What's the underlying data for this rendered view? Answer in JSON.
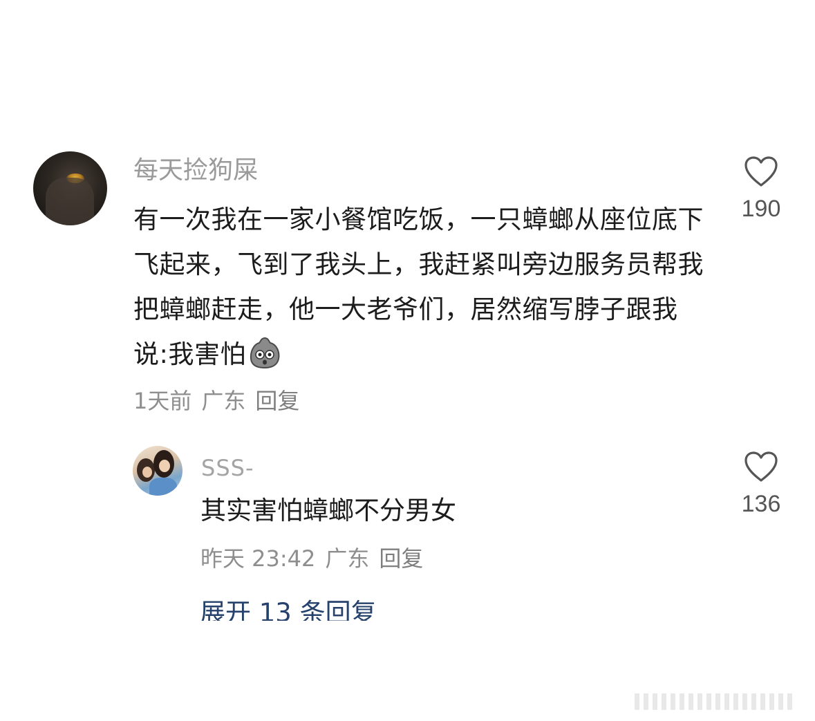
{
  "comment": {
    "username": "每天捡狗屎",
    "text": "有一次我在一家小餐馆吃饭，一只蟑螂从座位底下飞起来，飞到了我头上，我赶紧叫旁边服务员帮我把蟑螂赶走，他一大老爷们，居然缩写脖子跟我说:我害怕",
    "emoji_icon": "shocked-blob-emoji",
    "time": "1天前",
    "location": "广东",
    "reply_label": "回复",
    "like_count": "190",
    "like_icon": "heart-outline-icon"
  },
  "reply": {
    "username": "SSS-",
    "text": "其实害怕蟑螂不分男女",
    "time": "昨天 23:42",
    "location": "广东",
    "reply_label": "回复",
    "like_count": "136",
    "like_icon": "heart-outline-icon"
  },
  "expand_replies": {
    "label": "展开 13 条回复"
  },
  "colors": {
    "text_primary": "#1c1c1c",
    "text_secondary": "#8e8e8e",
    "link": "#26416b",
    "icon": "#555555"
  }
}
